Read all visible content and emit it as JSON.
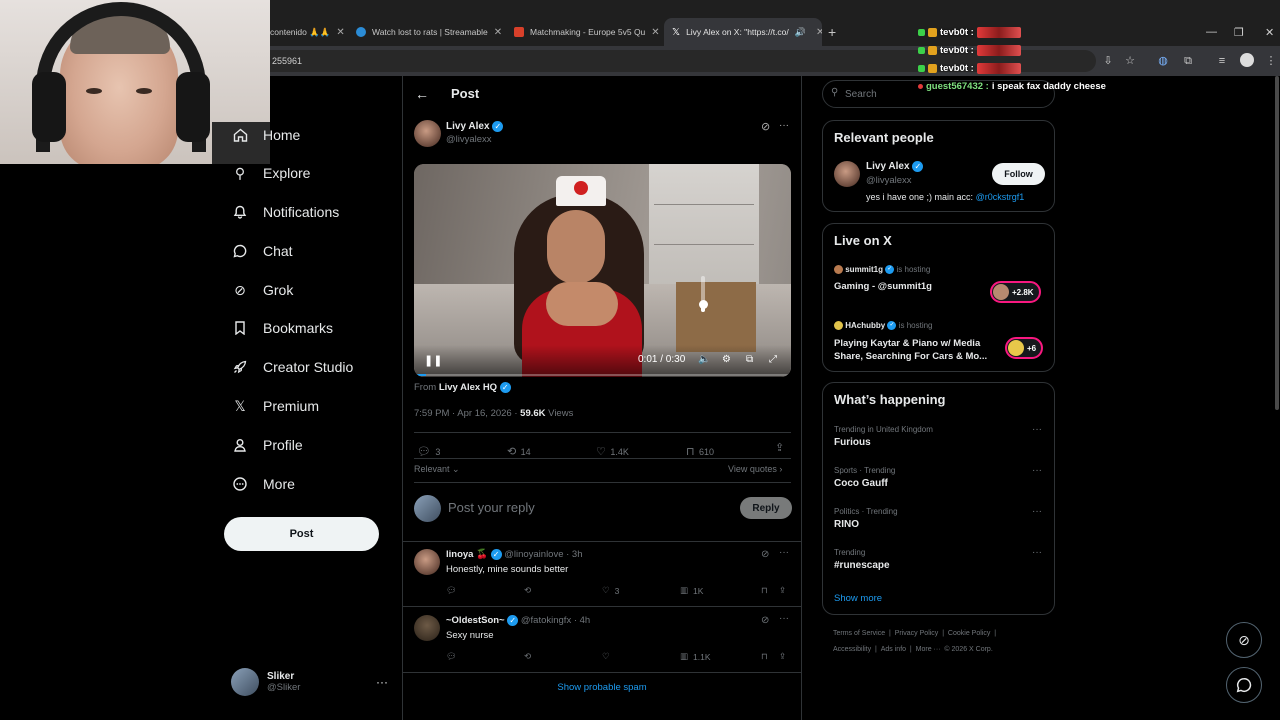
{
  "browser": {
    "tabs": [
      {
        "title": "contenido 🙏🙏",
        "fav": "#e0e0e0"
      },
      {
        "title": "Watch lost to rats | Streamable",
        "fav": "#2b8cd6"
      },
      {
        "title": "Matchmaking - Europe 5v5 Qu",
        "fav": "#d8402a"
      },
      {
        "title": "Livy Alex on X: \"https://t.co/",
        "fav": "#ffffff"
      }
    ],
    "new_tab": "+",
    "url_fragment": "255961",
    "window_controls": [
      "—",
      "❐",
      "✕"
    ]
  },
  "nav": {
    "items": [
      {
        "label": "Home",
        "icon": "⌂"
      },
      {
        "label": "Explore",
        "icon": "⚲"
      },
      {
        "label": "Notifications",
        "icon": "🔔"
      },
      {
        "label": "Chat",
        "icon": "◯"
      },
      {
        "label": "Grok",
        "icon": "⊘"
      },
      {
        "label": "Bookmarks",
        "icon": "🔖"
      },
      {
        "label": "Creator Studio",
        "icon": "🚀"
      },
      {
        "label": "Premium",
        "icon": "𝕏"
      },
      {
        "label": "Profile",
        "icon": "👤"
      },
      {
        "label": "More",
        "icon": "⋯"
      }
    ],
    "post_button": "Post",
    "account": {
      "name": "Sliker",
      "handle": "@Sliker",
      "more": "···"
    }
  },
  "post": {
    "header_title": "Post",
    "back_icon": "←",
    "author": {
      "name": "Livy Alex",
      "handle": "@livyalexx"
    },
    "more": "···",
    "video": {
      "time": "0:01 / 0:30",
      "volume": 0.22,
      "progress": 0.033
    },
    "from_label": "From",
    "from_name": "Livy Alex HQ",
    "timestamp": "7:59 PM · Apr 16, 2026 ·",
    "views_count": "59.6K",
    "views_label": "Views",
    "stats": {
      "replies": "3",
      "reposts": "14",
      "likes": "1.4K",
      "bookmarks": "610"
    },
    "sort_label": "Relevant",
    "view_quotes": "View quotes",
    "reply_placeholder": "Post your reply",
    "reply_button": "Reply"
  },
  "replies": [
    {
      "name": "linoya 🍒",
      "handle": "@linoyainlove · 3h",
      "text": "Honestly, mine sounds better",
      "likes": "3",
      "views": "1K"
    },
    {
      "name": "~OldestSon~",
      "handle": "@fatokingfx · 4h",
      "text": "Sexy nurse",
      "likes": "",
      "views": "1.1K"
    }
  ],
  "show_spam": "Show probable spam",
  "sidebar": {
    "search_placeholder": "Search",
    "relevant": {
      "title": "Relevant people",
      "name": "Livy Alex",
      "handle": "@livyalexx",
      "bio": "yes i have one ;) main acc: ",
      "bio_link": "@r0ckstrgf1",
      "follow": "Follow"
    },
    "live": {
      "title": "Live on X",
      "items": [
        {
          "host": "summit1g",
          "status": "is hosting",
          "title": "Gaming - @summit1g",
          "count": "+2.8K"
        },
        {
          "host": "HAchubby",
          "status": "is hosting",
          "title": "Playing Kaytar & Piano w/ Media Share, Searching For Cars & Mo...",
          "count": "+6"
        }
      ]
    },
    "trends": {
      "title": "What’s happening",
      "items": [
        {
          "category": "Trending in United Kingdom",
          "name": "Furious"
        },
        {
          "category": "Sports · Trending",
          "name": "Coco Gauff"
        },
        {
          "category": "Politics · Trending",
          "name": "RINO"
        },
        {
          "category": "Trending",
          "name": "#runescape"
        }
      ],
      "show_more": "Show more"
    },
    "footer": [
      "Terms of Service",
      "|",
      "Privacy Policy",
      "|",
      "Cookie Policy",
      "|",
      "Accessibility",
      "|",
      "Ads info",
      "|",
      "More ···",
      "© 2026 X Corp."
    ]
  },
  "chat": [
    {
      "user": "tevb0t :"
    },
    {
      "user": "tevb0t :"
    },
    {
      "user": "tevb0t :"
    },
    {
      "user": "guest567432 :",
      "message": "i speak fax daddy cheese"
    }
  ],
  "colors": {
    "accent": "#1d9bf0",
    "live": "#f91880",
    "background": "#000000"
  }
}
